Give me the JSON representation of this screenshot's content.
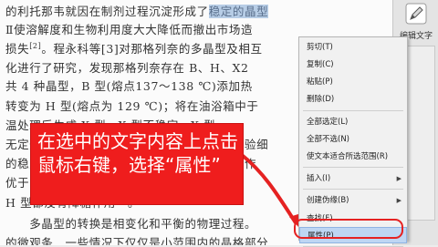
{
  "document": {
    "lines": [
      {
        "pre": "的利托那韦就因在制剂过程沉淀形成了稳定的晶型",
        "sup": "",
        "post": ""
      },
      {
        "pre": "Ⅱ使溶解度和生物利用度大大降低而撤出市场造",
        "sup": "",
        "post": ""
      },
      {
        "pre": "损失",
        "sup": "[2]",
        "post": "。程永科等[3]对那格列奈的多晶型及相互"
      },
      {
        "pre": "化进行了研究，发现那格列奈存在 B、H、X2",
        "sup": "",
        "post": ""
      },
      {
        "pre": "共 4 种晶型，B 型(熔点137～138 ℃)添加热",
        "sup": "",
        "post": ""
      },
      {
        "pre": "转变为 H 型(熔点为 129 ℃)；将在油浴箱中于",
        "sup": "",
        "post": ""
      },
      {
        "pre": "温处理后生成 X 型，X 型不稳定，X 型",
        "sup": "",
        "post": ""
      },
      {
        "pre": "无定形……在不同实验条件下均得到，通过实验细",
        "sup": "",
        "post": ""
      },
      {
        "pre": "的稳定……晶型具有更好的稳定性，在片剂的作",
        "sup": "",
        "post": ""
      },
      {
        "pre": "优于……型，其他晶型转变发生在这些晶型",
        "sup": "",
        "post": ""
      },
      {
        "pre": "H 型都没有降糖作用",
        "sup": "[4]",
        "post": "。"
      },
      {
        "pre": "　　多晶型的转换是相变化和平衡的物理过程。",
        "sup": "",
        "post": ""
      },
      {
        "pre": "的微观条…一些情况下仅仅是小范围内的晶格部分",
        "sup": "",
        "post": ""
      }
    ],
    "highlight_text": "稳定的晶型"
  },
  "right_panel": {
    "label": "编辑文字",
    "icon": "pencil-edit-icon"
  },
  "context_menu": {
    "items": [
      {
        "label": "剪切(T)",
        "submenu": false
      },
      {
        "label": "复制(C)",
        "submenu": false
      },
      {
        "label": "粘贴(P)",
        "submenu": false
      },
      {
        "label": "删除(D)",
        "submenu": false
      },
      {
        "label": "全部选定(L)",
        "submenu": false
      },
      {
        "label": "全部不选(N)",
        "submenu": false
      },
      {
        "label": "使文本适合所选范围(R)",
        "submenu": false
      },
      {
        "label": "插入(I)",
        "submenu": true
      },
      {
        "label": "创建伪缘(B)",
        "submenu": true
      },
      {
        "label": "查找(F)",
        "submenu": false
      },
      {
        "label": "属性(P)",
        "submenu": false
      }
    ],
    "active_index": 10
  },
  "callout": {
    "text": "在选中的文字内容上点击鼠标右键，选择“属性”"
  },
  "colors": {
    "callout_bg": "#ef1d1d",
    "selection": "#b7cde6",
    "menu_highlight": "#bed6f3",
    "ring": "#e52222"
  }
}
